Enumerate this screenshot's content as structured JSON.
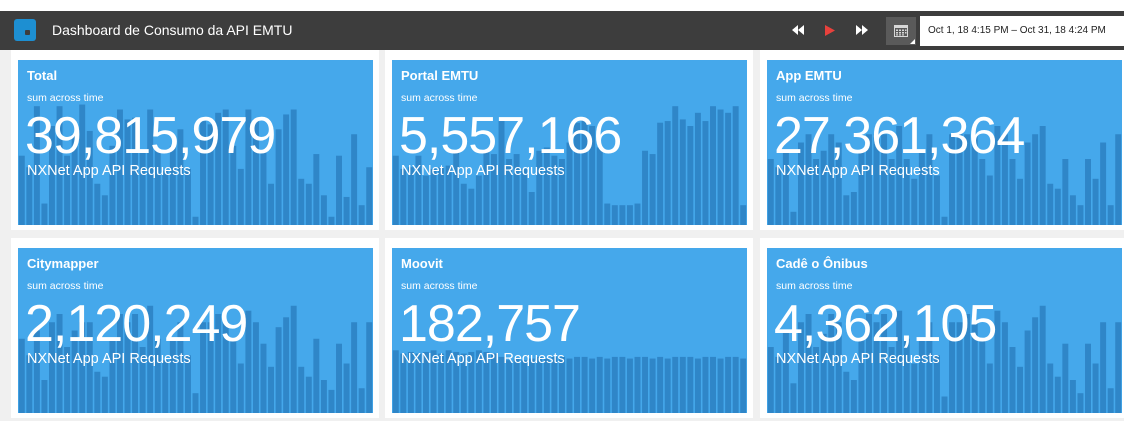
{
  "header": {
    "title": "Dashboard de Consumo da API EMTU",
    "date_range": "Oct 1, 18 4:15 PM – Oct 31, 18 4:24 PM",
    "icons": {
      "logo": "logo-icon",
      "rewind": "rewind-icon",
      "play": "play-icon",
      "fast_forward": "fast-forward-icon",
      "calendar": "calendar-icon"
    }
  },
  "colors": {
    "header_bg": "#3d3d3d",
    "logo": "#1d8fd2",
    "tile_bg": "#45a8eb",
    "bar": "#2f86c8",
    "play": "#e8413c"
  },
  "tiles": [
    {
      "name": "Total",
      "subtitle": "sum across time",
      "value": "39,815,979",
      "unit": "NXNet App API Requests",
      "bars": [
        0.42,
        0.35,
        0.72,
        0.13,
        0.6,
        0.72,
        0.42,
        0.55,
        0.73,
        0.57,
        0.25,
        0.18,
        0.48,
        0.7,
        0.64,
        0.65,
        0.45,
        0.7,
        0.46,
        0.33,
        0.48,
        0.58,
        0.34,
        0.05,
        0.63,
        0.61,
        0.68,
        0.7,
        0.48,
        0.34,
        0.7,
        0.64,
        0.45,
        0.25,
        0.58,
        0.67,
        0.7,
        0.28,
        0.25,
        0.43,
        0.18,
        0.05,
        0.42,
        0.17,
        0.55,
        0.12,
        0.35
      ]
    },
    {
      "name": "Portal EMTU",
      "subtitle": "sum across time",
      "value": "5,557,166",
      "unit": "NXNet App API Requests",
      "bars": [
        0.42,
        0.34,
        0.35,
        0.42,
        0.3,
        0.34,
        0.35,
        0.36,
        0.45,
        0.25,
        0.22,
        0.3,
        0.45,
        0.43,
        0.63,
        0.4,
        0.43,
        0.34,
        0.2,
        0.45,
        0.47,
        0.42,
        0.4,
        0.5,
        0.62,
        0.65,
        0.6,
        0.47,
        0.13,
        0.12,
        0.12,
        0.12,
        0.13,
        0.45,
        0.43,
        0.62,
        0.63,
        0.72,
        0.64,
        0.6,
        0.68,
        0.63,
        0.72,
        0.7,
        0.68,
        0.72,
        0.12
      ]
    },
    {
      "name": "App EMTU",
      "subtitle": "sum across time",
      "value": "27,361,364",
      "unit": "NXNet App API Requests",
      "bars": [
        0.4,
        0.35,
        0.45,
        0.08,
        0.5,
        0.55,
        0.4,
        0.45,
        0.55,
        0.5,
        0.18,
        0.2,
        0.45,
        0.55,
        0.55,
        0.55,
        0.4,
        0.6,
        0.4,
        0.28,
        0.45,
        0.55,
        0.3,
        0.05,
        0.55,
        0.55,
        0.55,
        0.55,
        0.4,
        0.3,
        0.6,
        0.55,
        0.4,
        0.28,
        0.5,
        0.55,
        0.6,
        0.25,
        0.22,
        0.4,
        0.18,
        0.12,
        0.4,
        0.28,
        0.5,
        0.12,
        0.55
      ]
    },
    {
      "name": "Citymapper",
      "subtitle": "sum across time",
      "value": "2,120,249",
      "unit": "NXNet App API Requests",
      "bars": [
        0.45,
        0.35,
        0.5,
        0.2,
        0.55,
        0.6,
        0.4,
        0.5,
        0.55,
        0.55,
        0.25,
        0.22,
        0.45,
        0.6,
        0.55,
        0.6,
        0.4,
        0.65,
        0.45,
        0.32,
        0.45,
        0.55,
        0.35,
        0.12,
        0.55,
        0.55,
        0.6,
        0.55,
        0.45,
        0.3,
        0.62,
        0.55,
        0.42,
        0.28,
        0.52,
        0.58,
        0.65,
        0.28,
        0.22,
        0.45,
        0.2,
        0.14,
        0.42,
        0.3,
        0.55,
        0.15,
        0.55
      ]
    },
    {
      "name": "Moovit",
      "subtitle": "sum across time",
      "value": "182,757",
      "unit": "NXNet App API Requests",
      "bars": [
        0.38,
        0.36,
        0.37,
        0.36,
        0.37,
        0.38,
        0.36,
        0.38,
        0.37,
        0.36,
        0.37,
        0.38,
        0.37,
        0.36,
        0.34,
        0.32,
        0.33,
        0.32,
        0.33,
        0.34,
        0.33,
        0.34,
        0.34,
        0.33,
        0.34,
        0.34,
        0.33,
        0.34,
        0.33,
        0.34,
        0.34,
        0.33,
        0.34,
        0.34,
        0.33,
        0.34,
        0.33,
        0.34,
        0.34,
        0.34,
        0.33,
        0.34,
        0.34,
        0.33,
        0.34,
        0.34,
        0.33
      ]
    },
    {
      "name": "Cadê o Ônibus",
      "subtitle": "sum across time",
      "value": "4,362,105",
      "unit": "NXNet App API Requests",
      "bars": [
        0.4,
        0.34,
        0.5,
        0.18,
        0.55,
        0.6,
        0.4,
        0.48,
        0.6,
        0.55,
        0.25,
        0.2,
        0.45,
        0.6,
        0.55,
        0.6,
        0.4,
        0.62,
        0.45,
        0.3,
        0.45,
        0.55,
        0.35,
        0.1,
        0.55,
        0.55,
        0.6,
        0.55,
        0.45,
        0.3,
        0.62,
        0.55,
        0.4,
        0.28,
        0.5,
        0.58,
        0.65,
        0.3,
        0.22,
        0.42,
        0.2,
        0.12,
        0.42,
        0.3,
        0.55,
        0.15,
        0.55
      ]
    }
  ]
}
